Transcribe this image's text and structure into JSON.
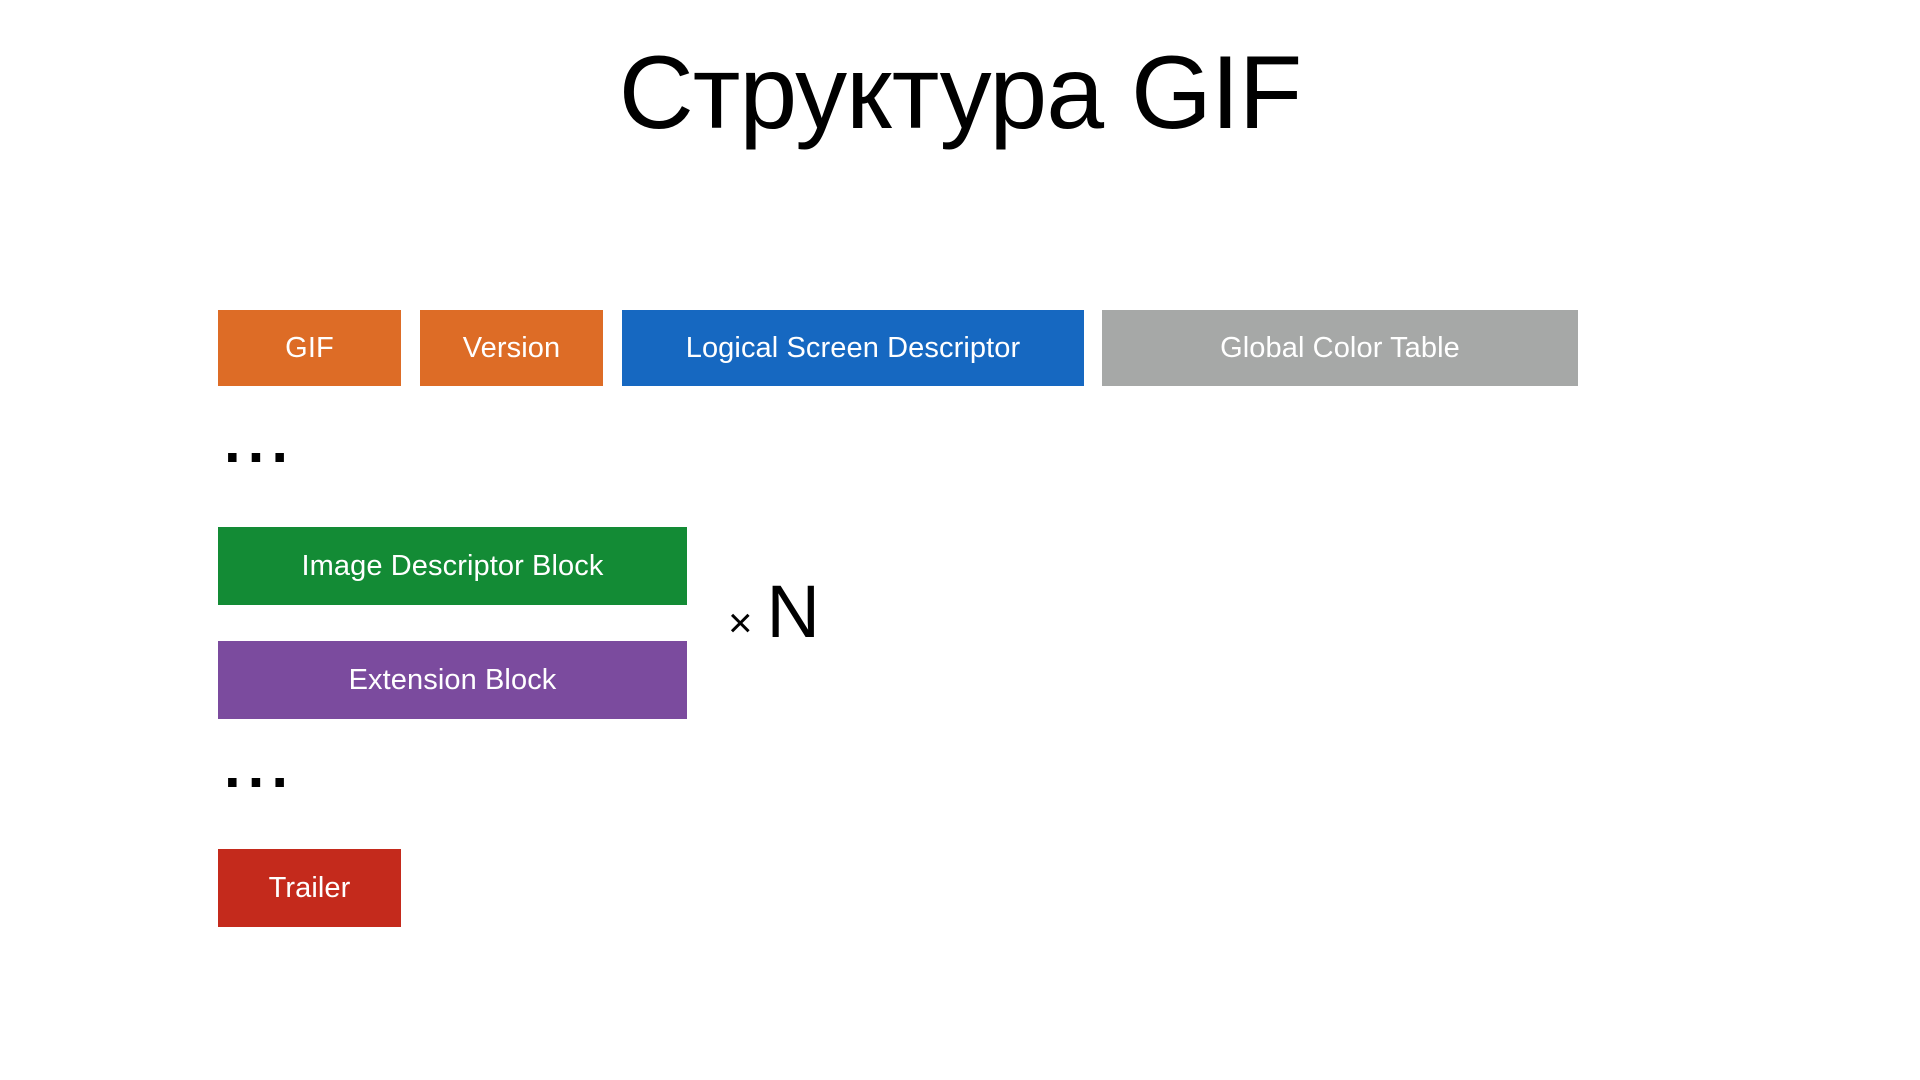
{
  "slide": {
    "title": "Структура GIF",
    "background_color": "#FFFFFF",
    "text_color": "#000000"
  },
  "diagram": {
    "type": "file-format-structure",
    "ellipsis_glyph": "...",
    "rows": [
      {
        "name": "header-row",
        "blocks": [
          {
            "label": "GIF",
            "color": "#DD6C26"
          },
          {
            "label": "Version",
            "color": "#DD6C26"
          },
          {
            "label": "Logical Screen Descriptor",
            "color": "#1668C1"
          },
          {
            "label": "Global Color Table",
            "color": "#A6A8A7"
          }
        ]
      },
      {
        "name": "frame-row",
        "blocks": [
          {
            "label": "Image Descriptor Block",
            "color": "#138B35"
          },
          {
            "label": "Extension Block",
            "color": "#7B4B9E"
          }
        ]
      },
      {
        "name": "trailer-row",
        "blocks": [
          {
            "label": "Trailer",
            "color": "#C42A1C"
          }
        ]
      }
    ],
    "multiplier": {
      "sign": "×",
      "count": "N"
    }
  }
}
